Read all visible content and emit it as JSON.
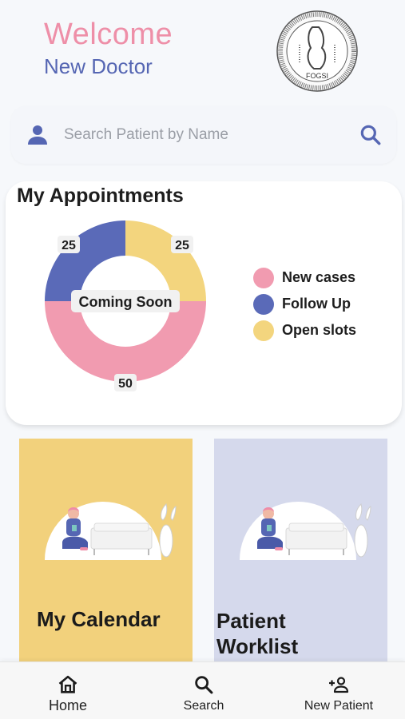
{
  "header": {
    "greeting": "Welcome",
    "user_name": "New Doctor",
    "logo_text": "FOGSI"
  },
  "search": {
    "placeholder": "Search Patient by Name"
  },
  "appointments": {
    "title": "My Appointments",
    "center_label": "Coming Soon"
  },
  "chart_data": {
    "type": "pie",
    "categories": [
      "New cases",
      "Follow Up",
      "Open slots"
    ],
    "values": [
      50,
      25,
      25
    ],
    "colors": [
      "#f19bb0",
      "#5a6ab8",
      "#f3d57e"
    ],
    "legend_position": "right"
  },
  "cards": [
    {
      "label": "My Calendar",
      "color": "#f2d17c"
    },
    {
      "label": "Patient Worklist",
      "color": "#d5d9ec"
    }
  ],
  "nav": {
    "items": [
      {
        "label": "Home",
        "icon": "home-icon"
      },
      {
        "label": "Search",
        "icon": "search-icon"
      },
      {
        "label": "New Patient",
        "icon": "add-person-icon"
      }
    ]
  },
  "colors": {
    "accent_pink": "#ee8fa8",
    "accent_blue": "#5566b3",
    "accent_yellow": "#f3d57e"
  }
}
